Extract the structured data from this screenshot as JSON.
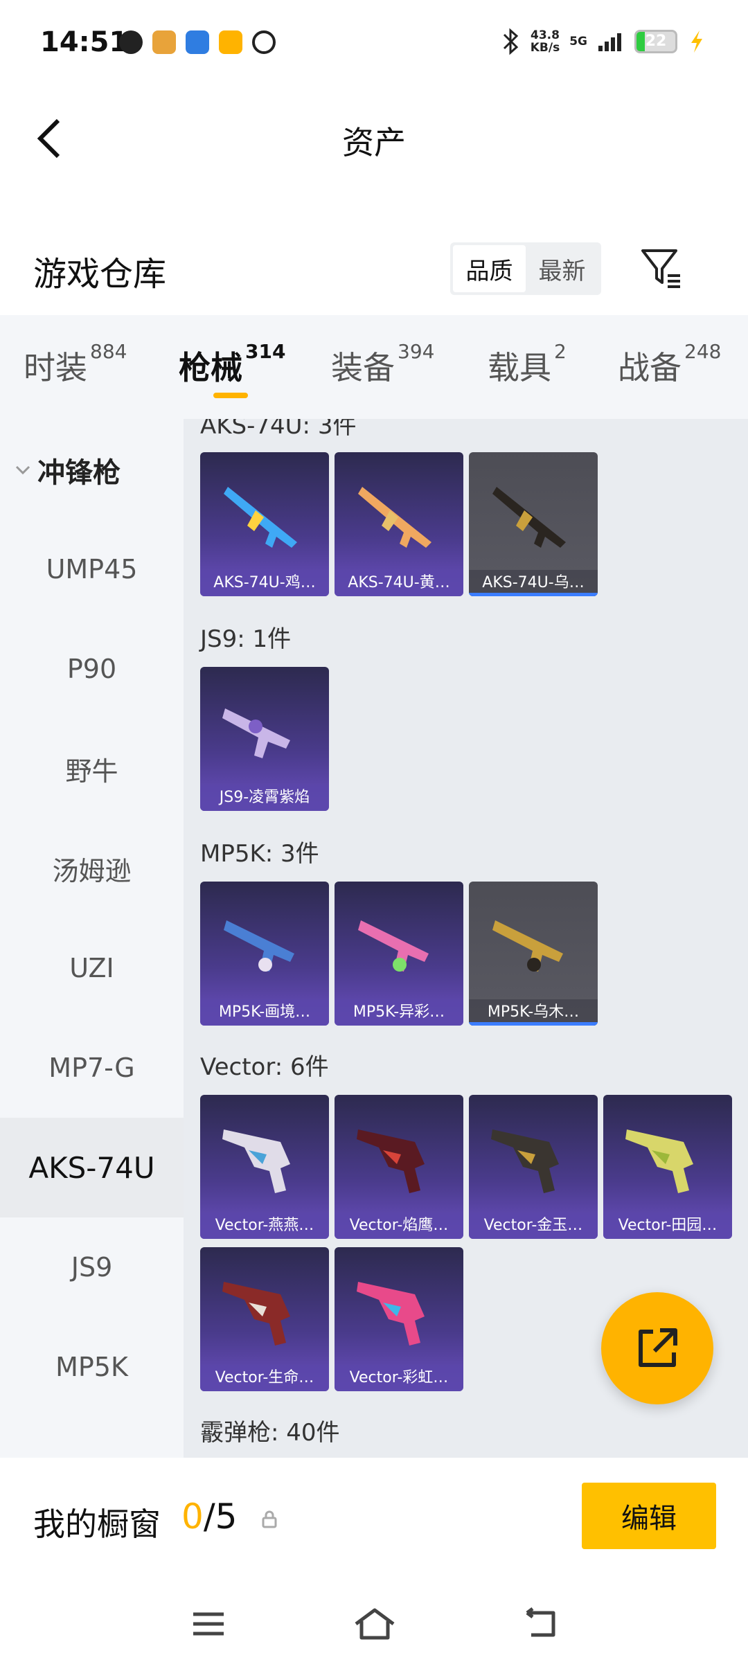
{
  "status_bar": {
    "time": "14:51",
    "net_speed_top": "43.8",
    "net_speed_unit": "KB/s",
    "network": "5G",
    "battery": "22",
    "battery_fraction": 0.22
  },
  "header": {
    "back_icon": "chevron-left-icon",
    "title": "资产"
  },
  "warehouse": {
    "title": "游戏仓库",
    "sort_options": [
      "品质",
      "最新"
    ],
    "sort_selected": "品质",
    "filter_icon": "filter-icon"
  },
  "tabs": [
    {
      "label": "时装",
      "count": "884"
    },
    {
      "label": "枪械",
      "count": "314"
    },
    {
      "label": "装备",
      "count": "394"
    },
    {
      "label": "载具",
      "count": "2"
    },
    {
      "label": "战备",
      "count": "248"
    }
  ],
  "active_tab": "枪械",
  "sidebar": {
    "group": "冲锋枪",
    "items": [
      "UMP45",
      "P90",
      "野牛",
      "汤姆逊",
      "UZI",
      "MP7-G",
      "AKS-74U",
      "JS9",
      "MP5K"
    ],
    "active": "AKS-74U"
  },
  "sections": [
    {
      "title": "AKS-74U: 3件",
      "items": [
        "AKS-74U-鸡…",
        "AKS-74U-黄…",
        "AKS-74U-乌…"
      ]
    },
    {
      "title": "JS9: 1件",
      "items": [
        "JS9-凌霄紫焰"
      ]
    },
    {
      "title": "MP5K: 3件",
      "items": [
        "MP5K-画境…",
        "MP5K-异彩…",
        "MP5K-乌木…"
      ]
    },
    {
      "title": "Vector: 6件",
      "items": [
        "Vector-燕燕…",
        "Vector-焰鹰…",
        "Vector-金玉…",
        "Vector-田园…",
        "Vector-生命…",
        "Vector-彩虹…"
      ]
    },
    {
      "title": "霰弹枪: 40件",
      "items": []
    }
  ],
  "showcase": {
    "label": "我的橱窗",
    "current": "0",
    "total": "/5",
    "edit_label": "编辑"
  },
  "colors": {
    "accent": "#ffb300",
    "card_purple": "#4a3b8c",
    "card_gray": "#55555e",
    "bg_light": "#f4f6f9"
  }
}
